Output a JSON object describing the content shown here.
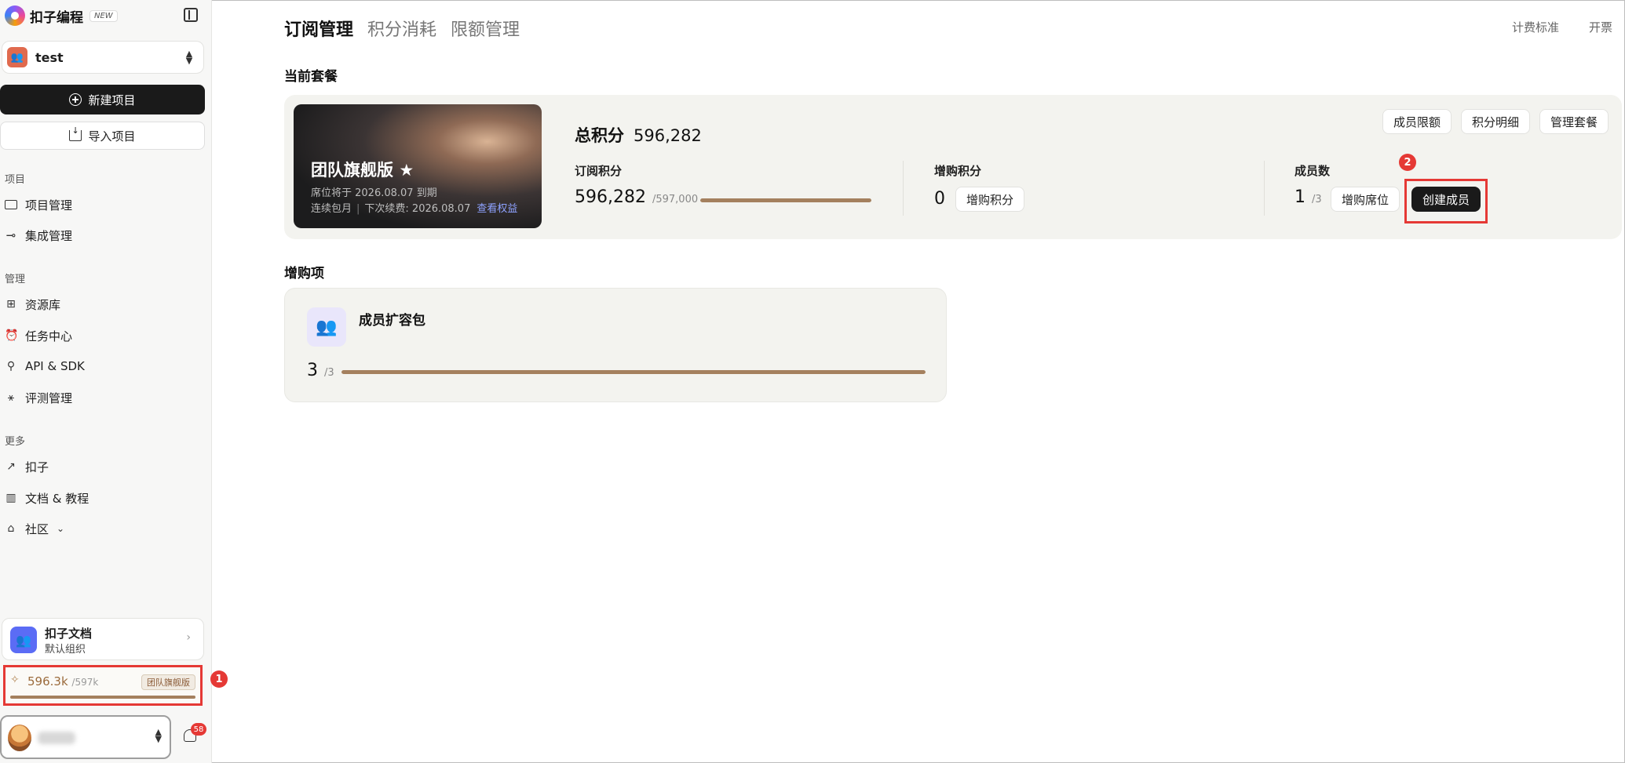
{
  "brand": {
    "name": "扣子编程",
    "badge": "NEW"
  },
  "workspace": {
    "name": "test"
  },
  "sidebar": {
    "new_project": "新建项目",
    "import_project": "导入项目",
    "section_project": "项目",
    "section_manage": "管理",
    "section_more": "更多",
    "items": [
      {
        "label": "项目管理",
        "icon": "folder-icon"
      },
      {
        "label": "集成管理",
        "icon": "signpost-icon"
      },
      {
        "label": "资源库",
        "icon": "grid-icon"
      },
      {
        "label": "任务中心",
        "icon": "alarm-icon"
      },
      {
        "label": "API & SDK",
        "icon": "api-icon"
      },
      {
        "label": "评测管理",
        "icon": "telescope-icon"
      },
      {
        "label": "扣子",
        "icon": "arrow-up-right-icon"
      },
      {
        "label": "文档 & 教程",
        "icon": "map-icon"
      },
      {
        "label": "社区",
        "icon": "store-icon"
      }
    ],
    "doc_card": {
      "title": "扣子文档",
      "subtitle": "默认组织"
    },
    "credits": {
      "value": "596.3k",
      "total": "/597k",
      "badge": "团队旗舰版",
      "fill_ratio": 0.999
    },
    "notification_count": "58"
  },
  "markers": {
    "one": "1",
    "two": "2"
  },
  "tabs": [
    {
      "label": "订阅管理",
      "active": true
    },
    {
      "label": "积分消耗",
      "active": false
    },
    {
      "label": "限额管理",
      "active": false
    }
  ],
  "top_links": {
    "pricing": "计费标准",
    "invoice": "开票"
  },
  "current_plan": {
    "section_title": "当前套餐",
    "name": "团队旗舰版",
    "seat_expiry": "席位将于 2026.08.07 到期",
    "renew_type": "连续包月",
    "next_renewal": "下次续费: 2026.08.07",
    "view_benefits": "查看权益",
    "total_label": "总积分",
    "total_value": "596,282",
    "buttons": {
      "member_limit": "成员限额",
      "credit_detail": "积分明细",
      "manage_plan": "管理套餐"
    },
    "subscription": {
      "label": "订阅积分",
      "value": "596,282",
      "total": "/597,000",
      "fill_ratio": 0.9988
    },
    "purchased": {
      "label": "增购积分",
      "value": "0",
      "button": "增购积分"
    },
    "members": {
      "label": "成员数",
      "value": "1",
      "total": "/3",
      "buy_seats": "增购席位",
      "create_member": "创建成员"
    }
  },
  "addons": {
    "section_title": "增购项",
    "card": {
      "title": "成员扩容包",
      "value": "3",
      "total": "/3",
      "fill_ratio": 1.0
    }
  },
  "colors": {
    "accent_bar": "#a4805e",
    "highlight": "#e53935",
    "dark_button": "#1a1a1a"
  }
}
